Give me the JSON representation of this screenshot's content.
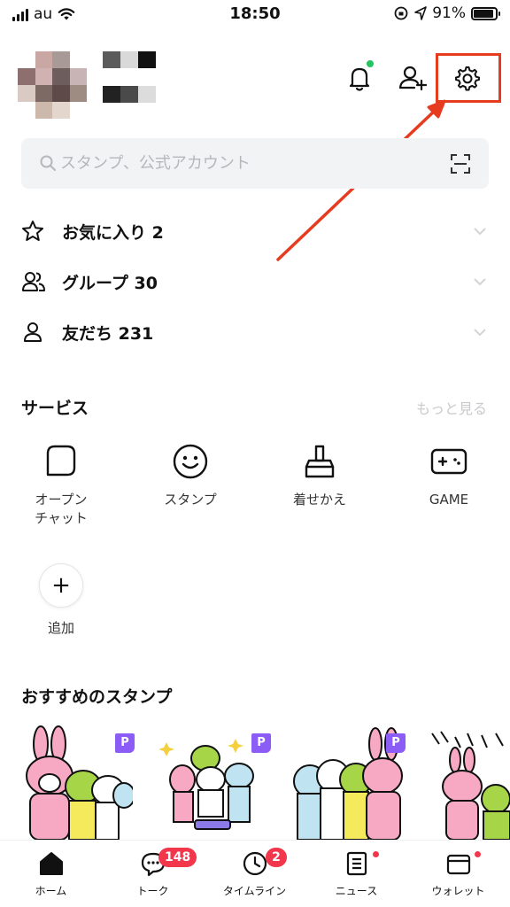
{
  "status_bar": {
    "carrier": "au",
    "time": "18:50",
    "battery_percent": "91%",
    "battery_level": 0.91
  },
  "header": {
    "bell_icon": "bell-icon",
    "add_friend_icon": "add-friend-icon",
    "settings_icon": "gear-icon",
    "highlight_color": "#e63b1f"
  },
  "search": {
    "placeholder": "スタンプ、公式アカウント"
  },
  "lists": {
    "favorites": "お気に入り 2",
    "groups": "グループ 30",
    "friends": "友だち 231"
  },
  "services": {
    "title": "サービス",
    "more": "もっと見る",
    "items": [
      {
        "label": "オープン\nチャット",
        "icon": "open-chat-icon"
      },
      {
        "label": "スタンプ",
        "icon": "smile-icon"
      },
      {
        "label": "着せかえ",
        "icon": "brush-icon"
      },
      {
        "label": "GAME",
        "icon": "gamepad-icon"
      }
    ],
    "add_label": "追加"
  },
  "stickers": {
    "title": "おすすめのスタンプ",
    "badge": "P"
  },
  "tabbar": {
    "home": "ホーム",
    "talk": "トーク",
    "talk_badge": "148",
    "timeline": "タイムライン",
    "timeline_badge": "2",
    "news": "ニュース",
    "wallet": "ウォレット"
  },
  "colors": {
    "accent_red": "#f2374d",
    "online_green": "#22c55e",
    "premium_purple": "#8b5cf6"
  }
}
